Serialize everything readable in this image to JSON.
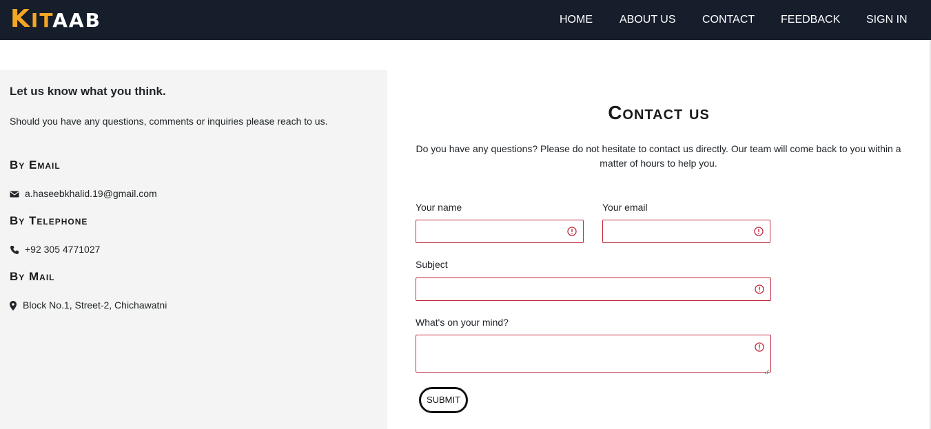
{
  "brand": {
    "k": "K",
    "it": "IT",
    "aab": "AAB"
  },
  "nav": [
    "HOME",
    "ABOUT US",
    "CONTACT",
    "FEEDBACK",
    "SIGN IN"
  ],
  "left": {
    "title": "Let us know what you think.",
    "subtitle": "Should you have any questions, comments or inquiries please reach to us.",
    "email_heading": "By Email",
    "email": "a.haseebkhalid.19@gmail.com",
    "phone_heading": "By Telephone",
    "phone": "+92 305 4771027",
    "mail_heading": "By Mail",
    "address": "Block No.1, Street-2, Chichawatni"
  },
  "contact": {
    "title": "Contact us",
    "description": "Do you have any questions? Please do not hesitate to contact us directly. Our team will come back to you within a matter of hours to help you.",
    "name_label": "Your name",
    "email_label": "Your email",
    "subject_label": "Subject",
    "message_label": "What's on your mind?",
    "submit_label": "SUBMIT"
  },
  "colors": {
    "navbar": "#161e2c",
    "accent": "#f5a623",
    "panel": "#f3f4f3",
    "error": "#c0283c"
  },
  "icons": {
    "email": "envelope-icon",
    "phone": "phone-icon",
    "mail": "map-marker-icon",
    "invalid": "exclamation-circle-icon"
  }
}
